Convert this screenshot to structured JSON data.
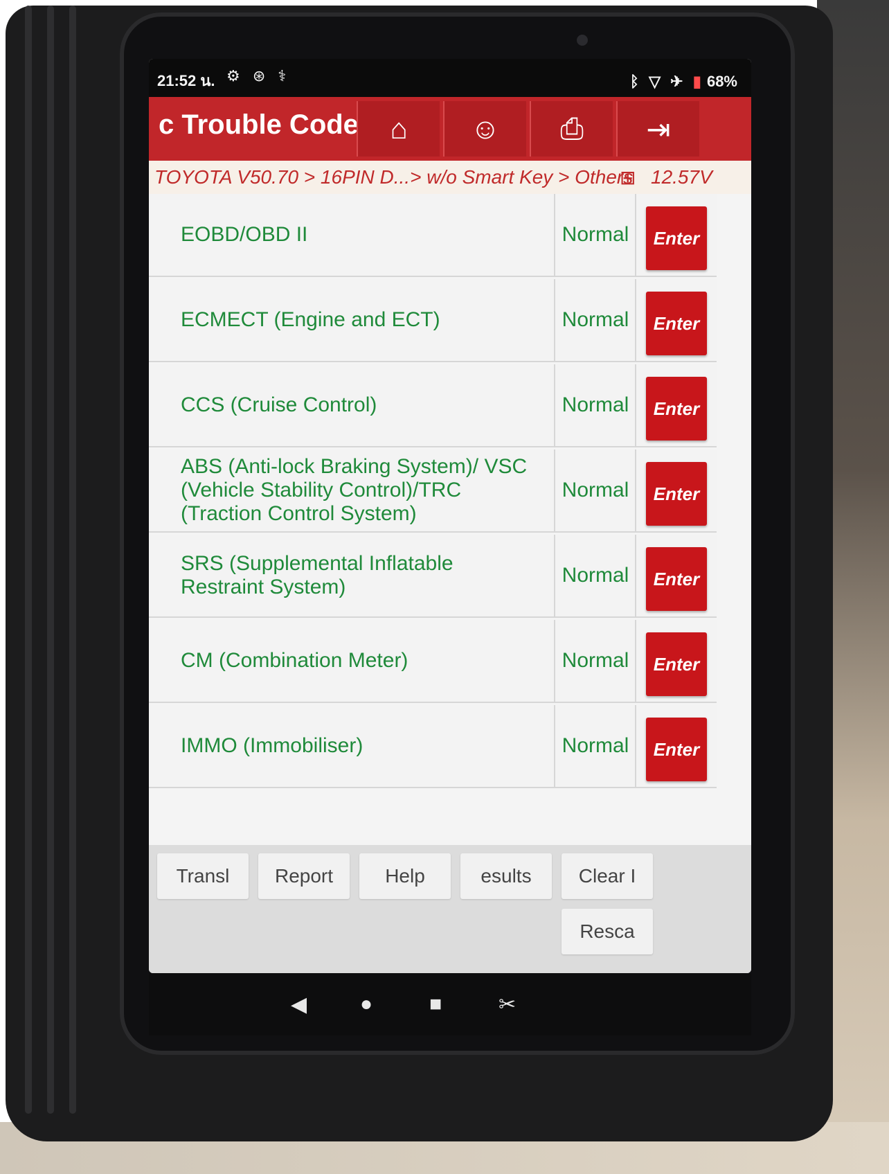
{
  "status_bar": {
    "time": "21:52 น.",
    "left_icons": [
      "gear-icon",
      "sync-icon",
      "stethoscope-icon"
    ],
    "right_icons": [
      "bluetooth-icon",
      "wifi-icon",
      "airplane-icon",
      "battery-icon"
    ],
    "battery": "68%"
  },
  "title_bar": {
    "title": "c Trouble Code",
    "buttons": [
      {
        "name": "home-button",
        "icon": "home-icon",
        "glyph": "⌂"
      },
      {
        "name": "support-button",
        "icon": "user-support-icon",
        "glyph": "☺"
      },
      {
        "name": "print-button",
        "icon": "printer-icon",
        "glyph": "⎙"
      },
      {
        "name": "exit-button",
        "icon": "exit-icon",
        "glyph": "⇥"
      }
    ]
  },
  "breadcrumb": {
    "path": "TOYOTA V50.70 > 16PIN D...> w/o Smart Key > Others",
    "voltage": "12.57V"
  },
  "systems": [
    {
      "name": "EOBD/OBD II",
      "status": "Normal",
      "action": "Enter"
    },
    {
      "name": "ECMECT (Engine and ECT)",
      "status": "Normal",
      "action": "Enter"
    },
    {
      "name": "CCS (Cruise Control)",
      "status": "Normal",
      "action": "Enter"
    },
    {
      "name": "ABS (Anti-lock Braking System)/ VSC (Vehicle Stability Control)/TRC (Traction Control System)",
      "status": "Normal",
      "action": "Enter"
    },
    {
      "name": "SRS (Supplemental Inflatable Restraint System)",
      "status": "Normal",
      "action": "Enter"
    },
    {
      "name": "CM (Combination Meter)",
      "status": "Normal",
      "action": "Enter"
    },
    {
      "name": "IMMO (Immobiliser)",
      "status": "Normal",
      "action": "Enter"
    }
  ],
  "toolbar": {
    "translate": "Transl",
    "report": "Report",
    "help": "Help",
    "results": "esults",
    "clear": "Clear I",
    "rescan": "Resca"
  },
  "nav": {
    "back": "◀",
    "home": "●",
    "recents": "■",
    "screenshot": "✂"
  },
  "colors": {
    "accent_red": "#c1262a",
    "text_green": "#1f8a3a"
  }
}
